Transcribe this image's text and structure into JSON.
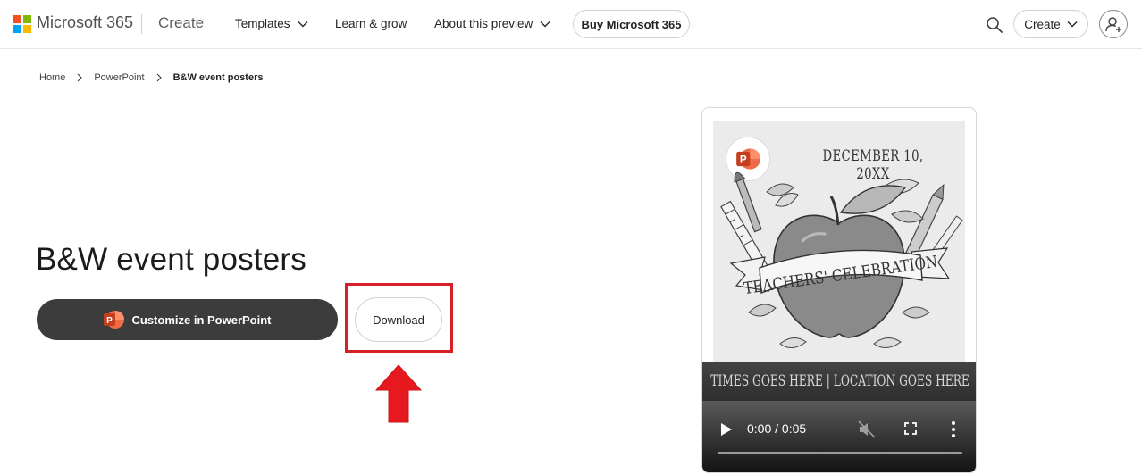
{
  "header": {
    "brand": "Microsoft 365",
    "section": "Create",
    "nav": [
      {
        "label": "Templates",
        "has_chevron": true
      },
      {
        "label": "Learn & grow",
        "has_chevron": false
      },
      {
        "label": "About this preview",
        "has_chevron": true
      }
    ],
    "buy_label": "Buy Microsoft 365",
    "create_label": "Create",
    "icons": {
      "search": "search-icon",
      "account": "account-icon",
      "chevron": "chevron-down-icon"
    }
  },
  "breadcrumb": {
    "items": [
      "Home",
      "PowerPoint"
    ],
    "current": "B&W event posters"
  },
  "main": {
    "title": "B&W event posters",
    "customize_label": "Customize in PowerPoint",
    "download_label": "Download"
  },
  "preview": {
    "poster_date": "DECEMBER 10, 20XX",
    "banner_text": "TEACHERS' CELEBRATION",
    "footer_text": "TIMES GOES HERE | LOCATION GOES HERE",
    "video_time": "0:00 / 0:05"
  },
  "colors": {
    "powerpoint": "#c43e1c",
    "highlight": "#d62027",
    "customize_bg": "#3c3c3c"
  }
}
